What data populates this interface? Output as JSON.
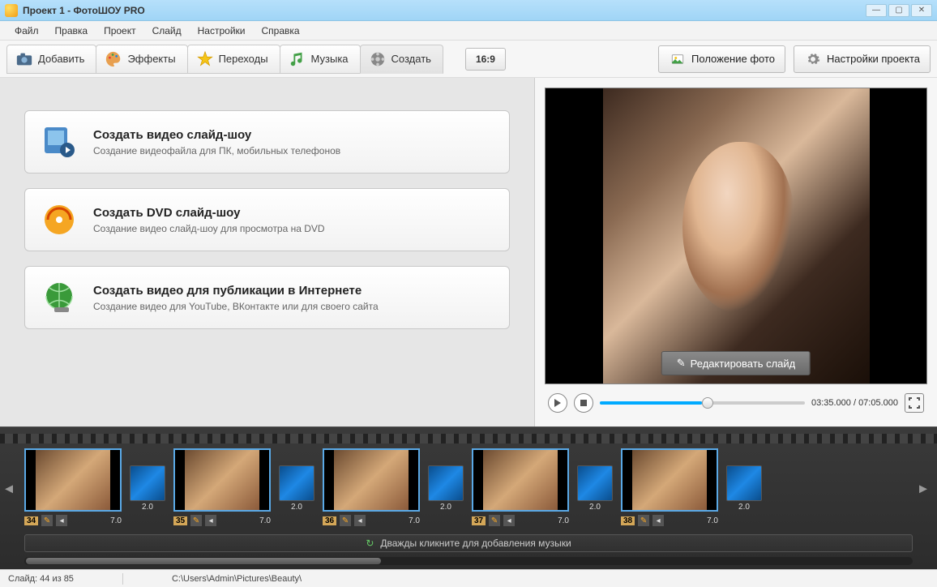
{
  "window": {
    "title": "Проект 1 - ФотоШОУ PRO"
  },
  "menu": {
    "items": [
      "Файл",
      "Правка",
      "Проект",
      "Слайд",
      "Настройки",
      "Справка"
    ]
  },
  "tabs": {
    "add": "Добавить",
    "effects": "Эффекты",
    "transitions": "Переходы",
    "music": "Музыка",
    "create": "Создать"
  },
  "aspect": "16:9",
  "buttons": {
    "photo_position": "Положение фото",
    "project_settings": "Настройки проекта",
    "edit_slide": "Редактировать слайд"
  },
  "create_cards": [
    {
      "title": "Создать видео слайд-шоу",
      "desc": "Создание видеофайла для ПК, мобильных телефонов"
    },
    {
      "title": "Создать DVD слайд-шоу",
      "desc": "Создание видео слайд-шоу для просмотра на DVD"
    },
    {
      "title": "Создать видео для публикации в Интернете",
      "desc": "Создание видео для YouTube, ВКонтакте или для своего сайта"
    }
  ],
  "playback": {
    "current": "03:35.000",
    "total": "07:05.000",
    "progress_pct": 50
  },
  "timeline": {
    "slides": [
      {
        "num": "34",
        "duration": "7.0",
        "trans_dur": "2.0"
      },
      {
        "num": "35",
        "duration": "7.0",
        "trans_dur": "2.0"
      },
      {
        "num": "36",
        "duration": "7.0",
        "trans_dur": "2.0"
      },
      {
        "num": "37",
        "duration": "7.0",
        "trans_dur": "2.0"
      },
      {
        "num": "38",
        "duration": "7.0",
        "trans_dur": "2.0"
      }
    ],
    "music_hint": "Дважды кликните для добавления музыки"
  },
  "status": {
    "slide_pos": "Слайд: 44 из 85",
    "path": "C:\\Users\\Admin\\Pictures\\Beauty\\"
  }
}
